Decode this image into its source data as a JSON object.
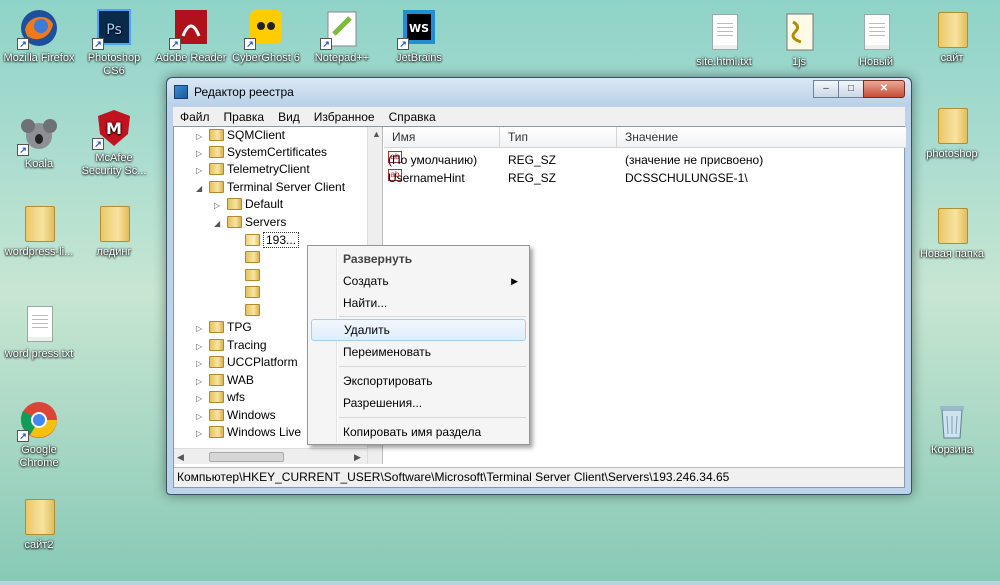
{
  "desktop": {
    "icons_left": [
      {
        "label": "Mozilla Firefox",
        "icon": "firefox-icon"
      },
      {
        "label": "Photoshop CS6",
        "icon": "photoshop-icon"
      },
      {
        "label": "Adobe Reader",
        "icon": "adobe-reader-icon"
      },
      {
        "label": "CyberGhost 6",
        "icon": "cyberghost-icon"
      },
      {
        "label": "Notepad++",
        "icon": "notepadpp-icon"
      },
      {
        "label": "JetBrains",
        "icon": "jetbrains-icon"
      },
      {
        "label": "Koala",
        "icon": "koala-icon"
      },
      {
        "label": "McAfee Security Sc...",
        "icon": "mcafee-icon"
      },
      {
        "label": "wordpress-li...",
        "icon": "folder-icon"
      },
      {
        "label": "лединг",
        "icon": "folder-icon"
      },
      {
        "label": "word press.txt",
        "icon": "text-file-icon"
      },
      {
        "label": "Google Chrome",
        "icon": "chrome-icon"
      },
      {
        "label": "сайт2",
        "icon": "folder-icon"
      }
    ],
    "icons_right": [
      {
        "label": "site.html.txt",
        "icon": "text-file-icon"
      },
      {
        "label": "1js",
        "icon": "script-file-icon"
      },
      {
        "label": "Новый",
        "icon": "text-file-icon"
      },
      {
        "label": "сайт",
        "icon": "folder-icon"
      },
      {
        "label": "photoshop",
        "icon": "folder-icon"
      },
      {
        "label": "Новая папка",
        "icon": "folder-icon"
      },
      {
        "label": "Корзина",
        "icon": "recycle-bin-icon"
      }
    ]
  },
  "window": {
    "title": "Редактор реестра",
    "controls": {
      "minimize": "–",
      "maximize": "□",
      "close": "✕"
    },
    "menu": [
      "Файл",
      "Правка",
      "Вид",
      "Избранное",
      "Справка"
    ]
  },
  "tree": {
    "items": [
      {
        "label": "SQMClient",
        "expander": "▷",
        "level": 0
      },
      {
        "label": "SystemCertificates",
        "expander": "▷",
        "level": 0
      },
      {
        "label": "TelemetryClient",
        "expander": "▷",
        "level": 0
      },
      {
        "label": "Terminal Server Client",
        "expander": "◢",
        "level": 0
      },
      {
        "label": "Default",
        "expander": "▷",
        "level": 1
      },
      {
        "label": "Servers",
        "expander": "◢",
        "level": 1
      },
      {
        "label": "193...",
        "expander": "",
        "level": 2,
        "selected": true
      },
      {
        "label": "",
        "expander": "",
        "level": 2
      },
      {
        "label": "",
        "expander": "",
        "level": 2
      },
      {
        "label": "",
        "expander": "",
        "level": 2
      },
      {
        "label": "",
        "expander": "",
        "level": 2
      },
      {
        "label": "TPG",
        "expander": "▷",
        "level": 0
      },
      {
        "label": "Tracing",
        "expander": "▷",
        "level": 0
      },
      {
        "label": "UCCPlatform",
        "expander": "▷",
        "level": 0
      },
      {
        "label": "WAB",
        "expander": "▷",
        "level": 0
      },
      {
        "label": "wfs",
        "expander": "▷",
        "level": 0
      },
      {
        "label": "Windows",
        "expander": "▷",
        "level": 0
      },
      {
        "label": "Windows Live",
        "expander": "▷",
        "level": 0
      }
    ]
  },
  "list": {
    "columns": [
      "Имя",
      "Тип",
      "Значение"
    ],
    "rows": [
      {
        "name": "(По умолчанию)",
        "type": "REG_SZ",
        "value": "(значение не присвоено)"
      },
      {
        "name": "UsernameHint",
        "type": "REG_SZ",
        "value": "DCSSCHULUNGSE-1\\"
      }
    ]
  },
  "context_menu": {
    "items": [
      {
        "label": "Развернуть",
        "style": "bold"
      },
      {
        "label": "Создать",
        "submenu": true
      },
      {
        "label": "Найти..."
      },
      {
        "label": "Удалить",
        "highlighted": true
      },
      {
        "label": "Переименовать"
      },
      {
        "label": "Экспортировать"
      },
      {
        "label": "Разрешения..."
      },
      {
        "label": "Копировать имя раздела"
      }
    ]
  },
  "status_path": "Компьютер\\HKEY_CURRENT_USER\\Software\\Microsoft\\Terminal Server Client\\Servers\\193.246.34.65"
}
